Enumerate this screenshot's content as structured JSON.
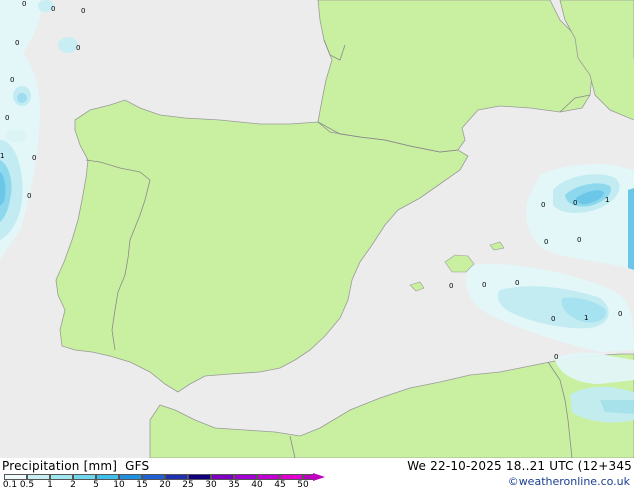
{
  "legend": {
    "title": "Precipitation [mm]",
    "model": "GFS",
    "datetime": "We 22-10-2025 18..21 UTC (12+345",
    "copyright": "©weatheronline.co.uk",
    "ticks": [
      "0.1",
      "0.5",
      "1",
      "2",
      "5",
      "10",
      "15",
      "20",
      "25",
      "30",
      "35",
      "40",
      "45",
      "50"
    ],
    "colors": [
      "#f0fafa",
      "#c8f0f0",
      "#a0e8f0",
      "#70d8ec",
      "#40c0e8",
      "#2090e0",
      "#2060d0",
      "#2030b0",
      "#100080",
      "#8000c0",
      "#a000d0",
      "#c000d0",
      "#e000d0",
      "#c000c0"
    ]
  },
  "map": {
    "sea_color": "#ececec",
    "land_color": "#c8f0a0",
    "border_color": "#8a8a8a",
    "cell_labels": [
      "0",
      "0",
      "0",
      "0",
      "0",
      "0",
      "0",
      "0",
      "1",
      "0",
      "0",
      "1",
      "0",
      "0",
      "0",
      "0",
      "0",
      "0",
      "1",
      "0",
      "0",
      "0"
    ]
  }
}
